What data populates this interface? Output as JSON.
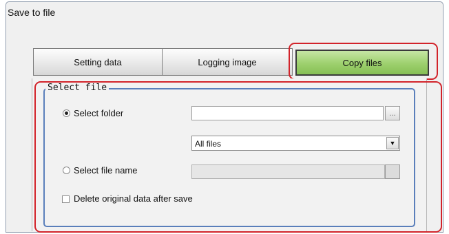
{
  "window": {
    "title": "Save to file"
  },
  "tabs": [
    {
      "label": "Setting data",
      "active": false
    },
    {
      "label": "Logging image",
      "active": false
    },
    {
      "label": "Copy files",
      "active": true
    }
  ],
  "select_file": {
    "legend": "Select file",
    "select_folder": {
      "label": "Select folder",
      "checked": true,
      "path_value": "",
      "browse_label": "..."
    },
    "file_filter": {
      "selected": "All files"
    },
    "select_file_name": {
      "label": "Select file name",
      "checked": false,
      "value": ""
    },
    "delete_original": {
      "label": "Delete original data after save",
      "checked": false
    }
  },
  "colors": {
    "active_tab": "#9dd06d",
    "highlight_outline": "#d2232a",
    "group_border": "#5a7fbb"
  }
}
